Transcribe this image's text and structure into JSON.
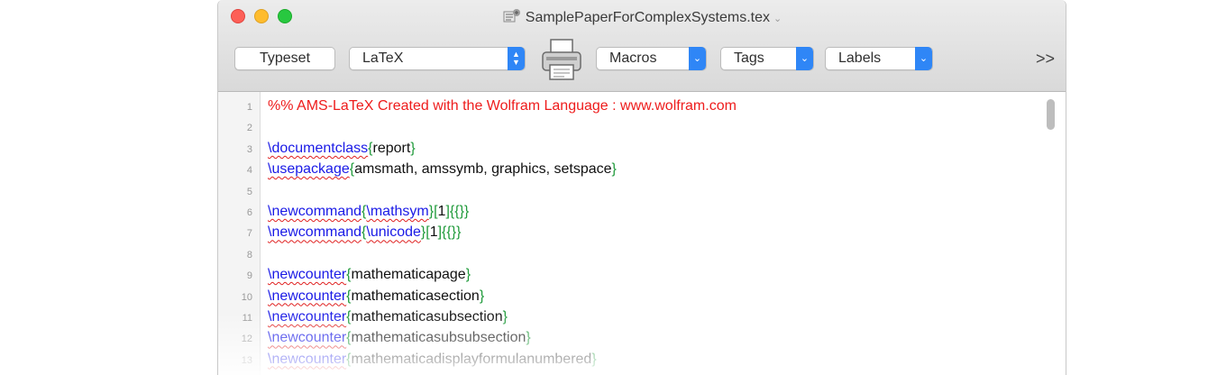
{
  "window": {
    "title": "SamplePaperForComplexSystems.tex"
  },
  "toolbar": {
    "typeset_label": "Typeset",
    "engine_value": "LaTeX",
    "macros_label": "Macros",
    "tags_label": "Tags",
    "labels_label": "Labels",
    "overflow_label": ">>"
  },
  "editor": {
    "lines": [
      {
        "n": "1",
        "text": "%% AMS-LaTeX Created with the Wolfram Language : www.wolfram.com"
      },
      {
        "n": "2",
        "text": ""
      },
      {
        "n": "3",
        "text": "\\documentclass{report}"
      },
      {
        "n": "4",
        "text": "\\usepackage{amsmath, amssymb, graphics, setspace}"
      },
      {
        "n": "5",
        "text": ""
      },
      {
        "n": "6",
        "text": "\\newcommand{\\mathsym}[1]{{}}"
      },
      {
        "n": "7",
        "text": "\\newcommand{\\unicode}[1]{{}}"
      },
      {
        "n": "8",
        "text": ""
      },
      {
        "n": "9",
        "text": "\\newcounter{mathematicapage}"
      },
      {
        "n": "10",
        "text": "\\newcounter{mathematicasection}"
      },
      {
        "n": "11",
        "text": "\\newcounter{mathematicasubsection}"
      },
      {
        "n": "12",
        "text": "\\newcounter{mathematicasubsubsection}"
      },
      {
        "n": "13",
        "text": "\\newcounter{mathematicadisplayformulanumbered}"
      }
    ]
  },
  "colors": {
    "comment": "#ee1c1c",
    "command": "#1a1ae6",
    "brace": "#1f9a3a",
    "spell_underline": "#e02020",
    "accent": "#2f86f6"
  }
}
